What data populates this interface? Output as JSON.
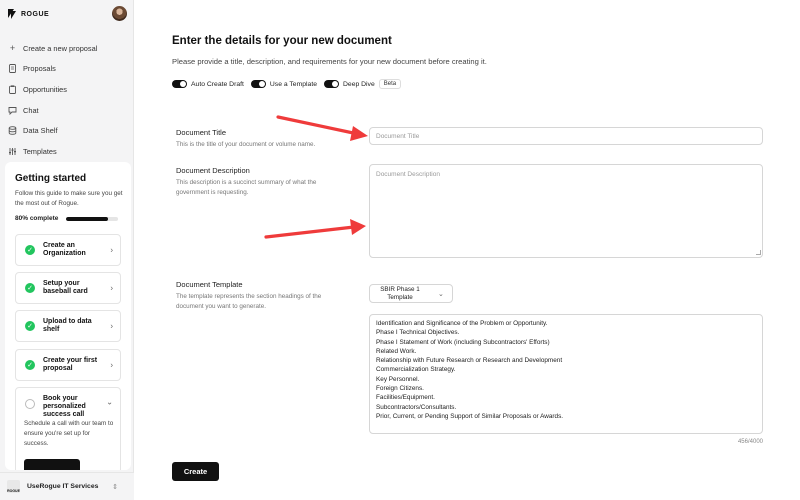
{
  "app": {
    "logo_text": "ROGUE",
    "avatar_icon": "user-avatar"
  },
  "sidebar": {
    "nav": [
      {
        "label": "Create a new proposal",
        "icon": "plus-icon"
      },
      {
        "label": "Proposals",
        "icon": "document-icon"
      },
      {
        "label": "Opportunities",
        "icon": "clipboard-icon"
      },
      {
        "label": "Chat",
        "icon": "chat-icon"
      },
      {
        "label": "Data Shelf",
        "icon": "database-icon"
      },
      {
        "label": "Templates",
        "icon": "sliders-icon"
      }
    ],
    "getting_started": {
      "title": "Getting started",
      "subtitle": "Follow this guide to make sure you get the most out of Rogue.",
      "progress_label": "80% complete",
      "progress": 0.8,
      "steps": [
        {
          "label": "Create an Organization",
          "done": true
        },
        {
          "label": "Setup your baseball card",
          "done": true
        },
        {
          "label": "Upload to data shelf",
          "done": true
        },
        {
          "label": "Create your first proposal",
          "done": true
        },
        {
          "label": "Book your personalized success call",
          "done": false,
          "description": "Schedule a call with our team to ensure you're set up for success."
        }
      ]
    },
    "org": {
      "logo_text": "ROGUE",
      "name": "UseRogue IT Services"
    }
  },
  "main": {
    "title": "Enter the details for your new document",
    "subtitle": "Please provide a title, description, and requirements for your new document before creating it.",
    "toggles": [
      {
        "label": "Auto Create Draft",
        "on": true
      },
      {
        "label": "Use a Template",
        "on": true
      },
      {
        "label": "Deep Dive",
        "on": true,
        "badge": "Beta"
      }
    ],
    "title_field": {
      "label": "Document Title",
      "help": "This is the title of your document or volume name.",
      "placeholder": "Document Title",
      "value": ""
    },
    "description_field": {
      "label": "Document Description",
      "help": "This description is a succinct summary of what the government is requesting.",
      "placeholder": "Document Description",
      "value": ""
    },
    "template_field": {
      "label": "Document Template",
      "help": "The template represents the section headings of the document you want to generate.",
      "selected": "SBIR Phase 1 Template",
      "sections": [
        "Identification and Significance of the Problem or Opportunity.",
        "Phase I Technical Objectives.",
        "Phase I Statement of Work (including Subcontractors' Efforts)",
        "Related Work.",
        "Relationship with Future Research or Research and Development",
        "Commercialization Strategy.",
        "Key Personnel.",
        "Foreign Citizens.",
        "Facilities/Equipment.",
        "Subcontractors/Consultants.",
        "Prior, Current, or Pending Support of Similar Proposals or Awards."
      ],
      "char_count": "456/4000"
    },
    "create_label": "Create"
  },
  "colors": {
    "accent": "#111111",
    "success": "#22c55e",
    "annotation_arrow": "#ef3b3b"
  }
}
